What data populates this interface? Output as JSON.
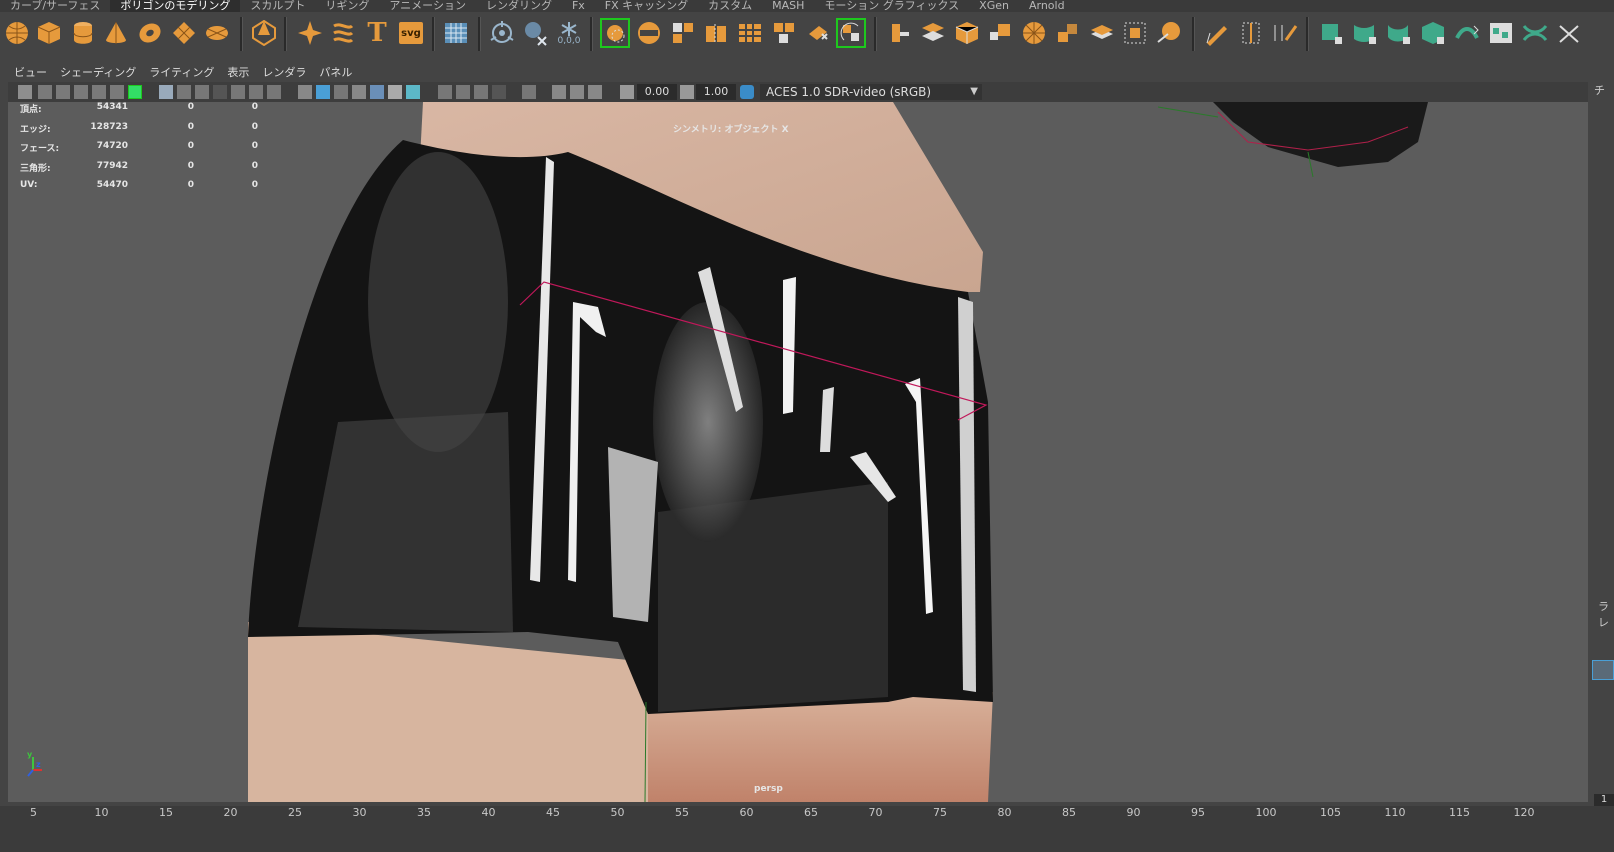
{
  "shelf_tabs": [
    {
      "label": "カーブ/サーフェス",
      "active": false
    },
    {
      "label": "ポリゴンのモデリング",
      "active": true
    },
    {
      "label": "スカルプト",
      "active": false
    },
    {
      "label": "リギング",
      "active": false
    },
    {
      "label": "アニメーション",
      "active": false
    },
    {
      "label": "レンダリング",
      "active": false
    },
    {
      "label": "Fx",
      "active": false
    },
    {
      "label": "FX キャッシング",
      "active": false
    },
    {
      "label": "カスタム",
      "active": false
    },
    {
      "label": "MASH",
      "active": false
    },
    {
      "label": "モーション グラフィックス",
      "active": false
    },
    {
      "label": "XGen",
      "active": false
    },
    {
      "label": "Arnold",
      "active": false
    }
  ],
  "shelf_icons": [
    "sphere-icon",
    "cube-icon",
    "cylinder-icon",
    "cone-icon",
    "torus-icon",
    "plane-icon",
    "disc-icon",
    "platonic-icon",
    "star-icon",
    "helix-icon",
    "text-t-icon",
    "svg-icon",
    "grid-icon",
    "symmetry-icon",
    "smooth-icon",
    "snowflake-icon",
    "snap-icon",
    "combine-icon",
    "separate-icon",
    "extract-icon",
    "boolean-icon",
    "mirror-icon",
    "reduce-icon",
    "cleanup-icon",
    "fill-hole-icon",
    "bridge-icon",
    "append-icon",
    "bevel-icon",
    "wedge-icon",
    "collapse-icon",
    "offset-icon",
    "poke-icon",
    "crease-icon",
    "smooth-mesh-icon",
    "connect-icon",
    "insert-loop-icon",
    "multi-cut-icon",
    "target-weld-icon",
    "pen-icon",
    "uv-planar-icon",
    "uv-cylinder-icon",
    "uv-sphere-icon",
    "uv-auto-icon",
    "uv-editor-icon",
    "uv-layout-icon",
    "uv-cut-icon"
  ],
  "shelf_text": {
    "svg": "svg",
    "snap_value": "0,0,0",
    "text_t": "T"
  },
  "panel_menu": [
    "ビュー",
    "シェーディング",
    "ライティング",
    "表示",
    "レンダラ",
    "パネル"
  ],
  "toolbar": {
    "exposure": "0.00",
    "gamma": "1.00",
    "color_space": "ACES 1.0 SDR-video (sRGB)"
  },
  "hud": {
    "rows": [
      {
        "label": "頂点:",
        "v1": "54341",
        "v2": "0",
        "v3": "0"
      },
      {
        "label": "エッジ:",
        "v1": "128723",
        "v2": "0",
        "v3": "0"
      },
      {
        "label": "フェース:",
        "v1": "74720",
        "v2": "0",
        "v3": "0"
      },
      {
        "label": "三角形:",
        "v1": "77942",
        "v2": "0",
        "v3": "0"
      },
      {
        "label": "UV:",
        "v1": "54470",
        "v2": "0",
        "v3": "0"
      }
    ],
    "symmetry": "シンメトリ: オブジェクト X",
    "camera": "persp",
    "axis_y": "y",
    "axis_z": "z"
  },
  "timeline": {
    "ticks": [
      "5",
      "10",
      "15",
      "20",
      "25",
      "30",
      "35",
      "40",
      "45",
      "50",
      "55",
      "60",
      "65",
      "70",
      "75",
      "80",
      "85",
      "90",
      "95",
      "100",
      "105",
      "110",
      "115",
      "120"
    ]
  },
  "right_strip": {
    "label_top": "チ",
    "label_1": "ラ",
    "label_2": "レ",
    "field": "1"
  }
}
